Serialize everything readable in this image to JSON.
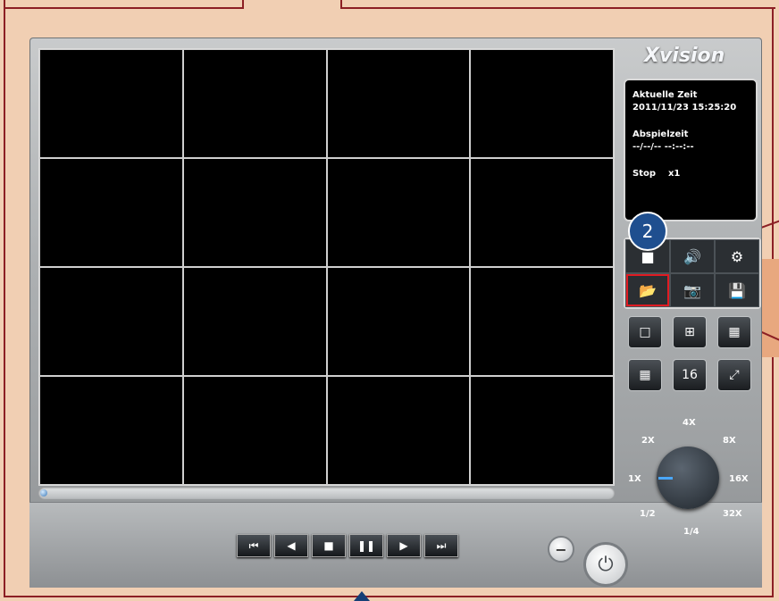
{
  "app": {
    "logo_text": "Xvision"
  },
  "info_panel": {
    "current_time_label": "Aktuelle Zeit",
    "current_time_value": "2011/11/23 15:25:20",
    "play_time_label": "Abspielzeit",
    "play_time_value": "--/--/-- --:--:--",
    "status": "Stop",
    "speed": "x1"
  },
  "step_badge": {
    "number": "2"
  },
  "tools": {
    "row1": [
      "camera-icon",
      "speaker-icon",
      "gear-icon"
    ],
    "row2": [
      "folder-icon",
      "snapshot-icon",
      "save-icon"
    ]
  },
  "layout_buttons": {
    "labels": [
      "",
      "",
      "",
      "",
      "16",
      ""
    ]
  },
  "speed_dial": {
    "labels": [
      "4X",
      "2X",
      "8X",
      "1X",
      "16X",
      "1/2",
      "32X",
      "1/4"
    ],
    "selected": "1X"
  },
  "playback": {
    "buttons": [
      "⏮",
      "◀",
      "■",
      "❚❚",
      "▶",
      "⏭"
    ]
  },
  "colors": {
    "accent_blue": "#1f4f8f",
    "highlight_red": "#e01b22",
    "page_bg": "#f1cfb3"
  }
}
